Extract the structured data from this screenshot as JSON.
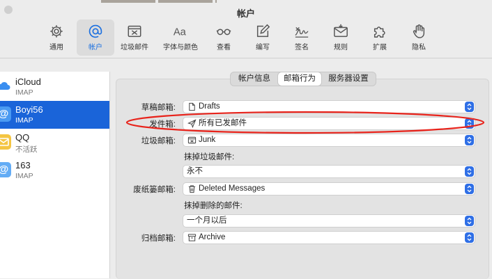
{
  "window": {
    "title": "帐户"
  },
  "toolbar": {
    "items": [
      {
        "label": "通用",
        "icon": "gear-icon"
      },
      {
        "label": "帐户",
        "icon": "at-icon",
        "active": true
      },
      {
        "label": "垃圾邮件",
        "icon": "junk-tray-icon"
      },
      {
        "label": "字体与颜色",
        "icon": "font-icon"
      },
      {
        "label": "查看",
        "icon": "glasses-icon"
      },
      {
        "label": "编写",
        "icon": "compose-icon"
      },
      {
        "label": "签名",
        "icon": "signature-icon"
      },
      {
        "label": "规则",
        "icon": "rules-envelope-icon"
      },
      {
        "label": "扩展",
        "icon": "puzzle-icon"
      },
      {
        "label": "隐私",
        "icon": "hand-icon"
      }
    ]
  },
  "sidebar": {
    "accounts": [
      {
        "name": "iCloud",
        "type": "IMAP",
        "icon": "cloud-icon"
      },
      {
        "name": "Boyi56",
        "type": "IMAP",
        "icon": "at-icon",
        "selected": true
      },
      {
        "name": "QQ",
        "type": "不活跃",
        "icon": "envelope-icon"
      },
      {
        "name": "163",
        "type": "IMAP",
        "icon": "at-icon"
      }
    ]
  },
  "tabs": [
    "帐户信息",
    "邮箱行为",
    "服务器设置"
  ],
  "active_tab": "邮箱行为",
  "mailbox_behavior": {
    "drafts": {
      "label": "草稿邮箱:",
      "value": "Drafts"
    },
    "sent": {
      "label": "发件箱:",
      "value": "所有已发邮件"
    },
    "junk": {
      "label": "垃圾邮箱:",
      "value": "Junk"
    },
    "erase_junk": {
      "label": "抹掉垃圾邮件:",
      "value": "永不"
    },
    "trash": {
      "label": "废纸篓邮箱:",
      "value": "Deleted Messages"
    },
    "erase_deleted": {
      "label": "抹掉删除的邮件:",
      "value": "一个月以后"
    },
    "archive": {
      "label": "归档邮箱:",
      "value": "Archive"
    }
  },
  "colors": {
    "accent": "#1a64d9",
    "annotation": "#e8231b",
    "popup_button": "#2f6fe6"
  }
}
